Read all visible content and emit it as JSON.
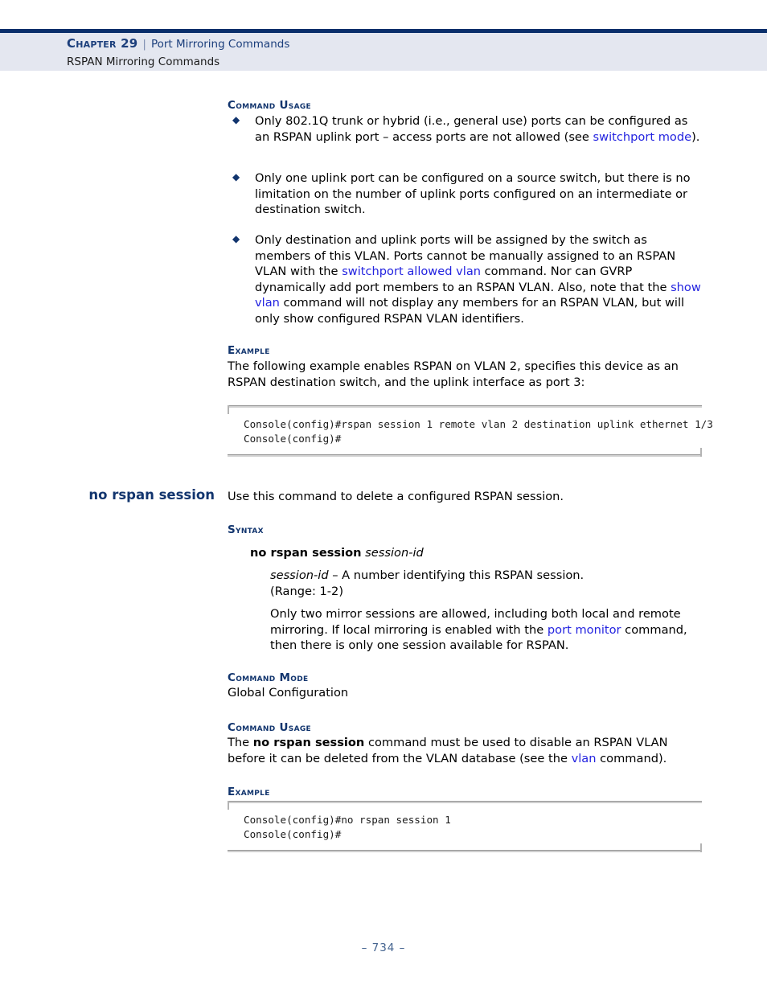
{
  "header": {
    "chapter_label": "Chapter 29",
    "separator": "|",
    "chapter_title": "Port Mirroring Commands",
    "section_title": "RSPAN Mirroring Commands"
  },
  "section_headings": {
    "command_usage": "Command Usage",
    "example": "Example",
    "syntax": "Syntax",
    "command_mode": "Command Mode"
  },
  "bullet_glyph": "◆",
  "rspan_session": {
    "usage_bullets": [
      {
        "parts": [
          {
            "text": "Only 802.1Q trunk or hybrid (i.e., general use) ports can be configured as an RSPAN uplink port – access ports are not allowed (see ",
            "style": "plain"
          },
          {
            "text": "switchport mode",
            "style": "link"
          },
          {
            "text": ").",
            "style": "plain"
          }
        ]
      },
      {
        "parts": [
          {
            "text": "Only one uplink port can be configured on a source switch, but there is no limitation on the number of uplink ports configured on an intermediate or destination switch.",
            "style": "plain"
          }
        ]
      },
      {
        "parts": [
          {
            "text": "Only destination and uplink ports will be assigned by the switch as members of this VLAN. Ports cannot be manually assigned to an RSPAN VLAN with the ",
            "style": "plain"
          },
          {
            "text": "switchport allowed vlan",
            "style": "link"
          },
          {
            "text": " command. Nor can GVRP dynamically add port members to an RSPAN VLAN. Also, note that the ",
            "style": "plain"
          },
          {
            "text": "show vlan",
            "style": "link"
          },
          {
            "text": " command will not display any members for an RSPAN VLAN, but will only show configured RSPAN VLAN identifiers.",
            "style": "plain"
          }
        ]
      }
    ],
    "example_intro": "The following example enables RSPAN on VLAN 2, specifies this device as an RSPAN destination switch, and the uplink interface as port 3:",
    "example_code": "Console(config)#rspan session 1 remote vlan 2 destination uplink ethernet 1/3\nConsole(config)#"
  },
  "no_rspan_session": {
    "command_name": "no rspan session",
    "intro": "Use this command to delete a configured RSPAN session.",
    "syntax_line": {
      "command": "no rspan session",
      "argument": "session-id"
    },
    "argument_description_line1": "session-id",
    "argument_description_line2": " – A number identifying this RSPAN session.",
    "argument_range": "(Range: 1-2)",
    "argument_note": {
      "parts": [
        {
          "text": "Only two mirror sessions are allowed, including both local and remote mirroring. If local mirroring is enabled with the ",
          "style": "plain"
        },
        {
          "text": "port monitor",
          "style": "link"
        },
        {
          "text": " command, then there is only one session available for RSPAN.",
          "style": "plain"
        }
      ]
    },
    "command_mode_value": "Global Configuration",
    "usage": {
      "parts": [
        {
          "text": "The ",
          "style": "plain"
        },
        {
          "text": "no rspan session",
          "style": "bold"
        },
        {
          "text": " command must be used to disable an RSPAN VLAN before it can be deleted from the VLAN database (see the ",
          "style": "plain"
        },
        {
          "text": "vlan",
          "style": "link"
        },
        {
          "text": " command).",
          "style": "plain"
        }
      ]
    },
    "example_code": "Console(config)#no rspan session 1\nConsole(config)#"
  },
  "footer": {
    "page_number": "–  734  –"
  },
  "colors": {
    "header_rule": "#0a2f6b",
    "header_band": "#e4e7f0",
    "heading_navy": "#12356e",
    "link_blue": "#2323e0",
    "footer_blue": "#43638f"
  }
}
